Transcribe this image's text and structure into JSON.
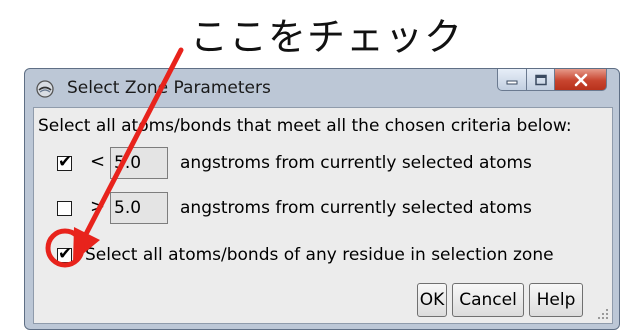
{
  "callout": {
    "text": "ここをチェック",
    "annotation_color": "#e8231c"
  },
  "window": {
    "title": "Select Zone Parameters",
    "controls": {
      "minimize": "minimize-icon",
      "maximize": "maximize-icon",
      "close": "close-icon"
    }
  },
  "dialog": {
    "instruction": "Select all atoms/bonds that meet all the chosen criteria below:",
    "criteria": [
      {
        "checked": true,
        "operator": "<",
        "value": "5.0",
        "label": "angstroms from currently selected atoms"
      },
      {
        "checked": false,
        "operator": ">",
        "value": "5.0",
        "label": "angstroms from currently selected atoms"
      }
    ],
    "residue_option": {
      "checked": true,
      "label": "Select all atoms/bonds of any residue in selection zone"
    },
    "buttons": {
      "ok": "OK",
      "cancel": "Cancel",
      "help": "Help"
    }
  }
}
